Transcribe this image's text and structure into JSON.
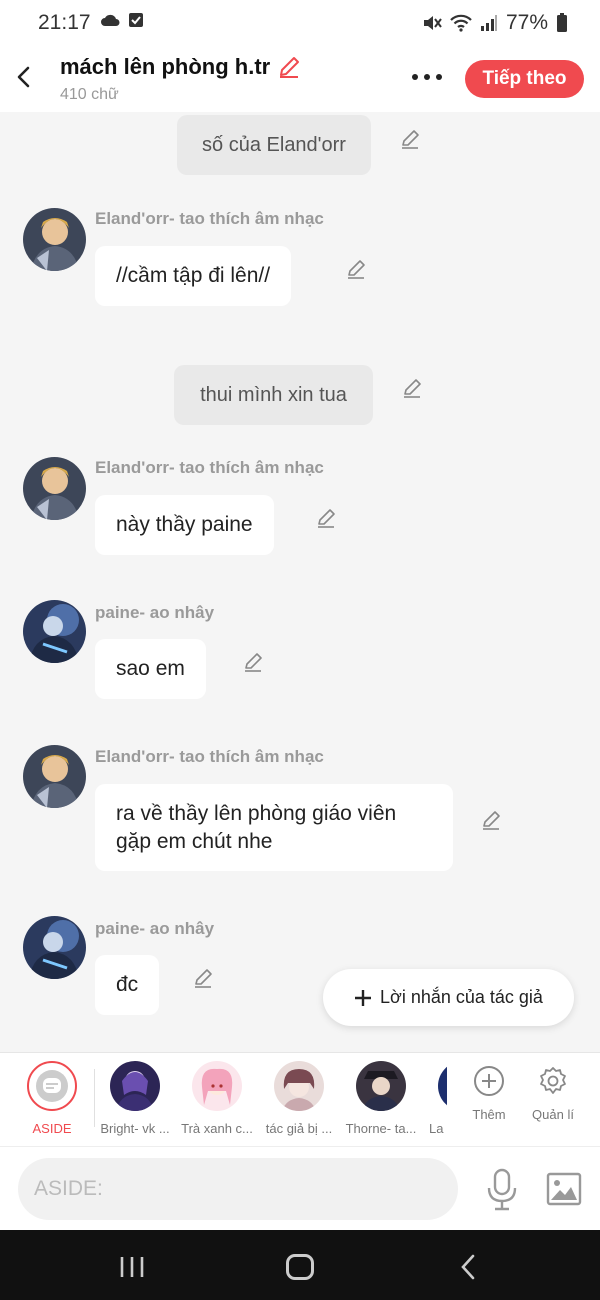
{
  "status": {
    "time": "21:17",
    "battery": "77%"
  },
  "header": {
    "title": "mách lên phòng h.tr",
    "word_count": "410 chữ",
    "next_label": "Tiếp theo"
  },
  "messages": {
    "m1": {
      "text": "số của Eland'orr"
    },
    "m2": {
      "sender": "Eland'orr- tao thích âm nhạc",
      "text": "//cầm tập đi lên//"
    },
    "m3": {
      "text": "thui mình xin tua"
    },
    "m4": {
      "sender": "Eland'orr- tao thích âm nhạc",
      "text": "này thầy paine"
    },
    "m5": {
      "sender": "paine- ao nhây",
      "text": "sao em"
    },
    "m6": {
      "sender": "Eland'orr- tao thích âm nhạc",
      "line1": "ra về thầy lên phòng giáo viên",
      "line2": "gặp em chút nhe"
    },
    "m7": {
      "sender": "paine- ao nhây",
      "text": "đc"
    }
  },
  "author_note_label": "Lời nhắn của tác giả",
  "characters": {
    "aside": "ASIDE",
    "c1": "Bright- vk ...",
    "c2": "Trà xanh c...",
    "c3": "tác giả bị ...",
    "c4": "Thorne- ta...",
    "c5": "La"
  },
  "tools": {
    "add": "Thêm",
    "manage": "Quản lí"
  },
  "input": {
    "placeholder": "ASIDE:"
  },
  "colors": {
    "accent": "#f04a4f",
    "background": "#f5f5f5"
  }
}
